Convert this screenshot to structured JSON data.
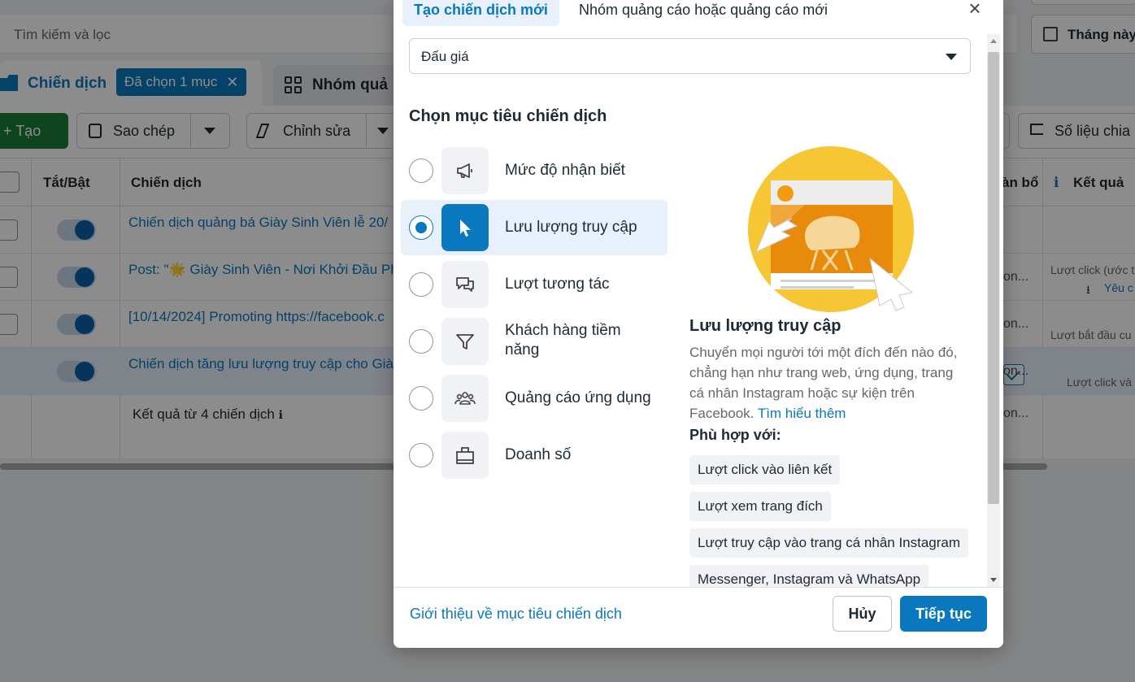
{
  "background": {
    "search_placeholder": "Tìm kiếm và lọc",
    "date_button": "Tháng này",
    "tabs": {
      "campaigns": "Chiến dịch",
      "selected_chip": "Đã chọn 1 mục",
      "adsets": "Nhóm quả"
    },
    "toolbar": {
      "create": "+ Tạo",
      "copy": "Sao chép",
      "edit": "Chỉnh sửa",
      "breakdown": "Số liệu chia"
    },
    "columns": {
      "toggle": "Tắt/Bật",
      "name": "Chiến dịch",
      "alloc": "àn bổ",
      "results": "Kết quả"
    },
    "rows": [
      {
        "name": "Chiến dịch quảng bá Giày Sinh Viên lễ 20/",
        "status": "",
        "result": ""
      },
      {
        "name": "Post: \"🌟 Giày Sinh Viên - Nơi Khởi Đầu Ph",
        "status": "on...",
        "result": "Lượt click (ước t"
      },
      {
        "name": "[10/14/2024] Promoting https://facebook.c",
        "status": "on...",
        "result": "Lượt bắt đầu cu"
      },
      {
        "name": "Chiến dịch tăng lưu lượng truy cập cho Già",
        "status": "on...",
        "result": ""
      }
    ],
    "row_extra": "Yêu c",
    "row4_result": "Lượt click và",
    "summary": "Kết quả từ 4 chiến dịch",
    "summary_status": "on..."
  },
  "modal": {
    "tab_active": "Tạo chiến dịch mới",
    "tab_other": "Nhóm quảng cáo hoặc quảng cáo mới",
    "close": "×",
    "buying_type": "Đấu giá",
    "heading": "Chọn mục tiêu chiến dịch",
    "objectives": [
      {
        "label": "Mức độ nhận biết",
        "icon": "megaphone-icon",
        "selected": false
      },
      {
        "label": "Lưu lượng truy cập",
        "icon": "cursor-icon",
        "selected": true
      },
      {
        "label": "Lượt tương tác",
        "icon": "chat-bubbles-icon",
        "selected": false
      },
      {
        "label": "Khách hàng tiềm năng",
        "icon": "funnel-icon",
        "selected": false
      },
      {
        "label": "Quảng cáo ứng dụng",
        "icon": "people-icon",
        "selected": false
      },
      {
        "label": "Doanh số",
        "icon": "shopping-bag-icon",
        "selected": false
      }
    ],
    "detail": {
      "title": "Lưu lượng truy cập",
      "description": "Chuyển mọi người tới một đích đến nào đó, chẳng hạn như trang web, ứng dụng, trang cá nhân Instagram hoặc sự kiện trên Facebook.",
      "learn_more": "Tìm hiểu thêm",
      "good_for_label": "Phù hợp với:",
      "good_for": [
        "Lượt click vào liên kết",
        "Lượt xem trang đích",
        "Lượt truy cập vào trang cá nhân Instagram",
        "Messenger, Instagram và WhatsApp"
      ]
    },
    "footer": {
      "about_link": "Giới thiệu về mục tiêu chiến dịch",
      "cancel": "Hủy",
      "continue": "Tiếp tục"
    }
  },
  "colors": {
    "accent": "#0a78be",
    "create_green": "#1a7f37",
    "overlay": "rgba(0,0,0,0.45)"
  }
}
